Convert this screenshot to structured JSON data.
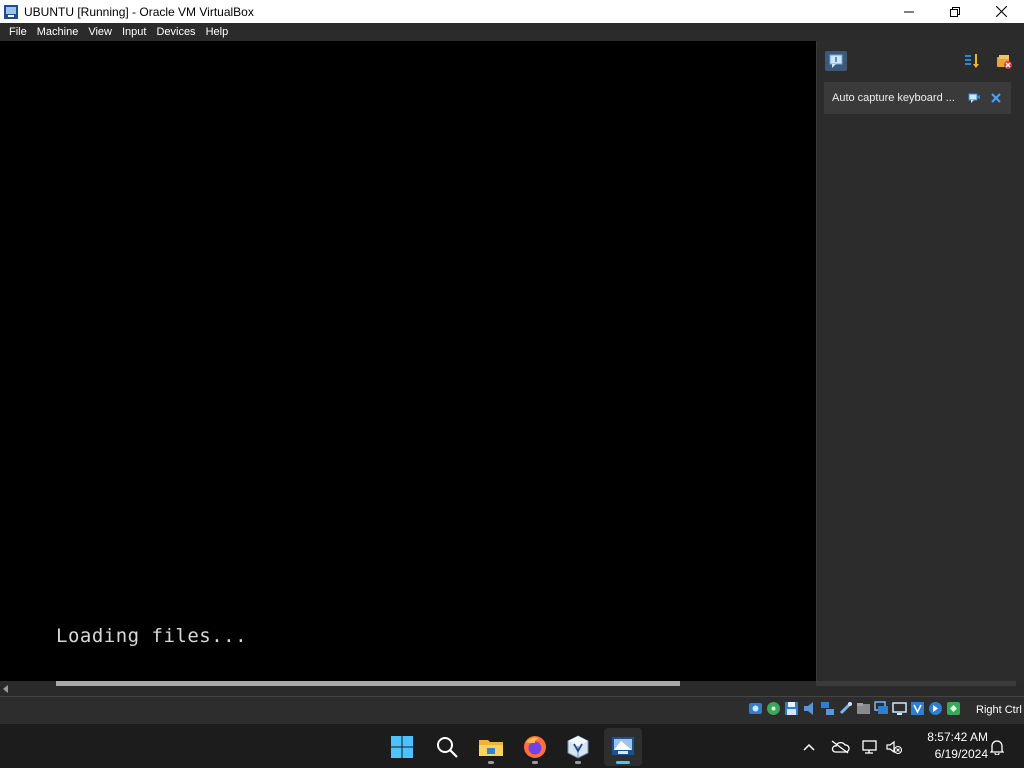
{
  "window": {
    "title": "UBUNTU [Running] - Oracle VM VirtualBox"
  },
  "menu": {
    "items": [
      "File",
      "Machine",
      "View",
      "Input",
      "Devices",
      "Help"
    ]
  },
  "vm": {
    "console_text": "Loading files..."
  },
  "notification_panel": {
    "notice_text": "Auto capture keyboard ..."
  },
  "statusbar": {
    "host_key": "Right Ctrl",
    "icons": [
      "harddisk-icon",
      "optical-drive-icon",
      "floppy-icon",
      "audio-icon",
      "network-icon",
      "usb-icon",
      "shared-folders-icon",
      "display-icon",
      "recording-icon",
      "vt-x-icon",
      "mouse-integration-icon",
      "keyboard-capture-icon"
    ]
  },
  "taskbar": {
    "apps": [
      "start-icon",
      "search-icon",
      "file-explorer-icon",
      "firefox-icon",
      "virtualbox-icon",
      "virtualbox-vm-icon"
    ],
    "time": "8:57:42 AM",
    "date": "6/19/2024"
  },
  "colors": {
    "titlebar": "#ffffff",
    "menubar": "#2b2b2b",
    "vm_background": "#000000",
    "panel": "#2c2c2c",
    "taskbar": "#1c1c1c",
    "accent": "#4cc2ff"
  }
}
